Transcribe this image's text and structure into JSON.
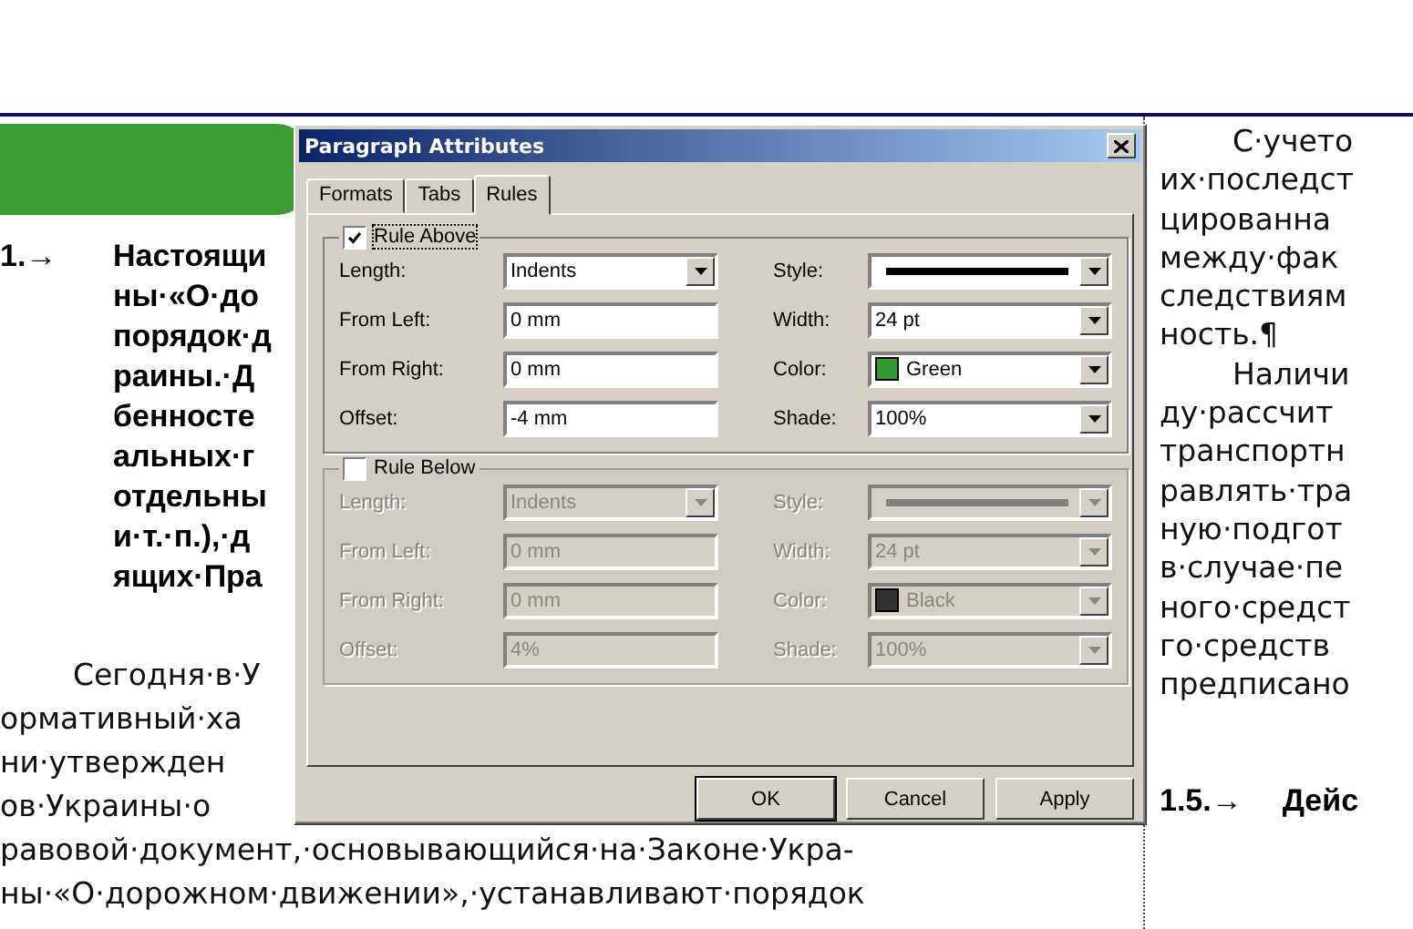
{
  "document": {
    "heading": {
      "number": "1.→",
      "lines": [
        "Настоящи",
        "ны·«О·до",
        "порядок·д",
        "раины.·Д",
        "бенносте",
        "альных·г",
        "отдельны",
        "и·т.·п.),·д",
        "ящих·Пра"
      ]
    },
    "left_body": [
      {
        "lines": [
          "Сегодня·в·У",
          "ормативный·ха",
          "ни·утвержден",
          "ов·Украины·о",
          "равовой·документ,·основывающийся·на·Законе·Укра-",
          "ны·«О·дорожном·движении»,·устанавливают·порядок"
        ]
      }
    ],
    "right_body": [
      {
        "lines": [
          "С·учето",
          "их·последст",
          "цированна",
          "между·фак",
          "следствиям",
          "ность.¶"
        ]
      },
      {
        "lines": [
          "Наличи",
          "ду·рассчит",
          "транспортн",
          "равлять·тра",
          "ную·подгот",
          "в·случае·пе",
          "ного·средст",
          "го·средств",
          "предписано"
        ]
      }
    ],
    "right_heading": {
      "number": "1.5.→",
      "text": "Дейс"
    }
  },
  "dialog": {
    "title": "Paragraph Attributes",
    "tabs": [
      {
        "label": "Formats",
        "selected": false
      },
      {
        "label": "Tabs",
        "selected": false
      },
      {
        "label": "Rules",
        "selected": true
      }
    ],
    "groups": [
      {
        "label": "Rule Above",
        "checked": true,
        "disabled": false,
        "left": [
          {
            "label": "Length:",
            "kind": "select",
            "value": "Indents"
          },
          {
            "label": "From Left:",
            "kind": "text",
            "value": "0 mm"
          },
          {
            "label": "From Right:",
            "kind": "text",
            "value": "0 mm"
          },
          {
            "label": "Offset:",
            "kind": "text",
            "value": "-4 mm"
          }
        ],
        "right": [
          {
            "label": "Style:",
            "kind": "line"
          },
          {
            "label": "Width:",
            "kind": "select",
            "value": "24 pt"
          },
          {
            "label": "Color:",
            "kind": "color",
            "value": "Green",
            "color": "#2f9a2f"
          },
          {
            "label": "Shade:",
            "kind": "select",
            "value": "100%"
          }
        ]
      },
      {
        "label": "Rule Below",
        "checked": false,
        "disabled": true,
        "left": [
          {
            "label": "Length:",
            "kind": "select",
            "value": "Indents"
          },
          {
            "label": "From Left:",
            "kind": "text",
            "value": "0 mm"
          },
          {
            "label": "From Right:",
            "kind": "text",
            "value": "0 mm"
          },
          {
            "label": "Offset:",
            "kind": "text",
            "value": "4%"
          }
        ],
        "right": [
          {
            "label": "Style:",
            "kind": "line"
          },
          {
            "label": "Width:",
            "kind": "select",
            "value": "24 pt"
          },
          {
            "label": "Color:",
            "kind": "color",
            "value": "Black",
            "color": "#333333"
          },
          {
            "label": "Shade:",
            "kind": "select",
            "value": "100%"
          }
        ]
      }
    ],
    "buttons": [
      {
        "label": "OK",
        "default": true
      },
      {
        "label": "Cancel",
        "default": false
      },
      {
        "label": "Apply",
        "default": false
      }
    ]
  }
}
